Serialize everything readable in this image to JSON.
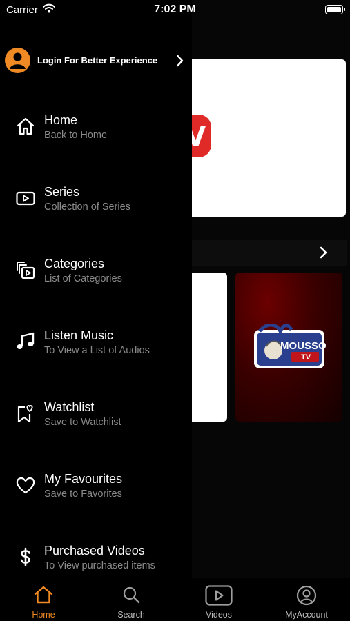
{
  "status_bar": {
    "carrier": "Carrier",
    "time": "7:02 PM"
  },
  "drawer": {
    "login_text": "Login For Better Experience",
    "items": [
      {
        "title": "Home",
        "subtitle": "Back to Home",
        "icon": "home-icon"
      },
      {
        "title": "Series",
        "subtitle": "Collection of Series",
        "icon": "play-box-icon"
      },
      {
        "title": "Categories",
        "subtitle": "List of Categories",
        "icon": "categories-icon"
      },
      {
        "title": "Listen Music",
        "subtitle": "To View a List of Audios",
        "icon": "music-note-icon"
      },
      {
        "title": "Watchlist",
        "subtitle": "Save to Watchlist",
        "icon": "bookmark-heart-icon"
      },
      {
        "title": "My Favourites",
        "subtitle": "Save to Favorites",
        "icon": "heart-icon"
      },
      {
        "title": "Purchased Videos",
        "subtitle": "To View purchased items",
        "icon": "dollar-icon"
      }
    ]
  },
  "background": {
    "thumbnail_logo_top": "MOUSSO",
    "thumbnail_logo_bottom": "TV"
  },
  "tab_bar": {
    "tabs": [
      {
        "label": "Home",
        "icon": "home-icon",
        "active": true
      },
      {
        "label": "Search",
        "icon": "search-icon",
        "active": false
      },
      {
        "label": "Videos",
        "icon": "play-box-icon",
        "active": false
      },
      {
        "label": "MyAccount",
        "icon": "account-icon",
        "active": false
      }
    ]
  },
  "colors": {
    "accent": "#f08a24",
    "background": "#000000",
    "subtitle": "#8a8a8a"
  }
}
